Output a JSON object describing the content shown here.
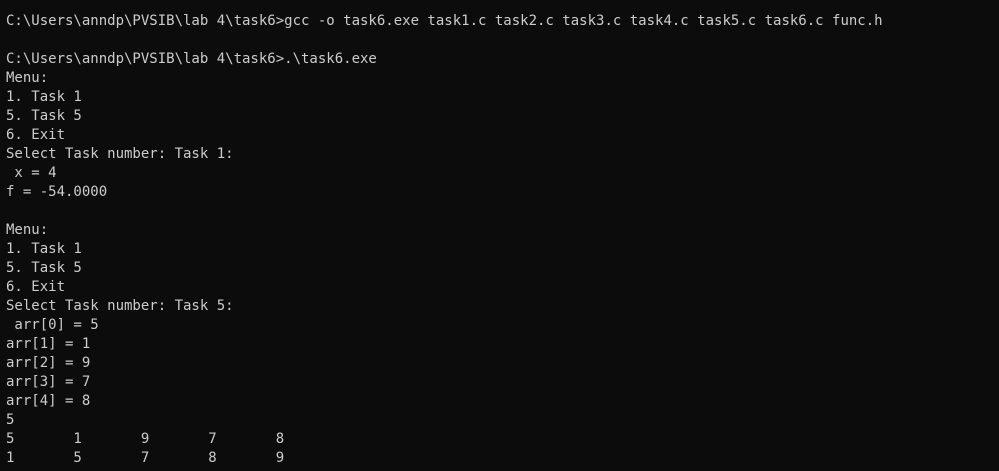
{
  "console": {
    "lines": [
      "C:\\Users\\anndp\\PVSIB\\lab 4\\task6>gcc -o task6.exe task1.c task2.c task3.c task4.c task5.c task6.c func.h",
      "",
      "C:\\Users\\anndp\\PVSIB\\lab 4\\task6>.\\task6.exe",
      "Menu:",
      "1. Task 1",
      "5. Task 5",
      "6. Exit",
      "Select Task number: Task 1:",
      " x = 4",
      "f = -54.0000",
      "",
      "Menu:",
      "1. Task 1",
      "5. Task 5",
      "6. Exit",
      "Select Task number: Task 5:",
      " arr[0] = 5",
      "arr[1] = 1",
      "arr[2] = 9",
      "arr[3] = 7",
      "arr[4] = 8",
      "5",
      "5       1       9       7       8",
      "1       5       7       8       9"
    ]
  },
  "colors": {
    "background": "#0c0c0c",
    "text": "#cccccc"
  }
}
